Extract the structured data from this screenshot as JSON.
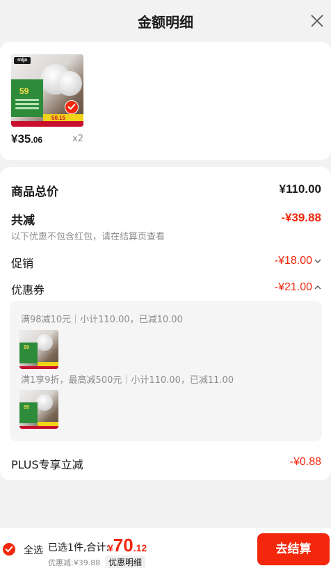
{
  "header": {
    "title": "金额明细"
  },
  "product": {
    "thumb_price_badge": "59",
    "thumb_price_tag": "50.15",
    "price_int": "¥35",
    "price_dec": ".06",
    "quantity": "x2"
  },
  "detail": {
    "subtotal_label": "商品总价",
    "subtotal_value": "¥110.00",
    "reduce_label": "共减",
    "reduce_value": "-¥39.88",
    "reduce_note": "以下优惠不包含红包，请在结算页查看",
    "promo_label": "促销",
    "promo_value": "-¥18.00",
    "coupon_label": "优惠券",
    "coupon_value": "-¥21.00",
    "coupons": [
      {
        "text": "满98减10元｜小计110.00，已减10.00"
      },
      {
        "text": "满1享9折，最高减500元｜小计110.00，已减11.00"
      }
    ],
    "plus_label": "PLUS专享立减",
    "plus_value": "-¥0.88"
  },
  "footer": {
    "select_all": "全选",
    "summary": "已选1件,合计:",
    "total_currency": "¥",
    "total_int": "70",
    "total_dec": ".12",
    "discount_note": "优惠减:¥39.88",
    "detail_tag": "优惠明细",
    "checkout": "去结算"
  },
  "colors": {
    "accent": "#f2270c",
    "background": "#f2f2f2",
    "muted": "#8c8c8c"
  },
  "icons": [
    "close-icon",
    "check-icon",
    "chevron-down-icon",
    "chevron-up-icon"
  ]
}
